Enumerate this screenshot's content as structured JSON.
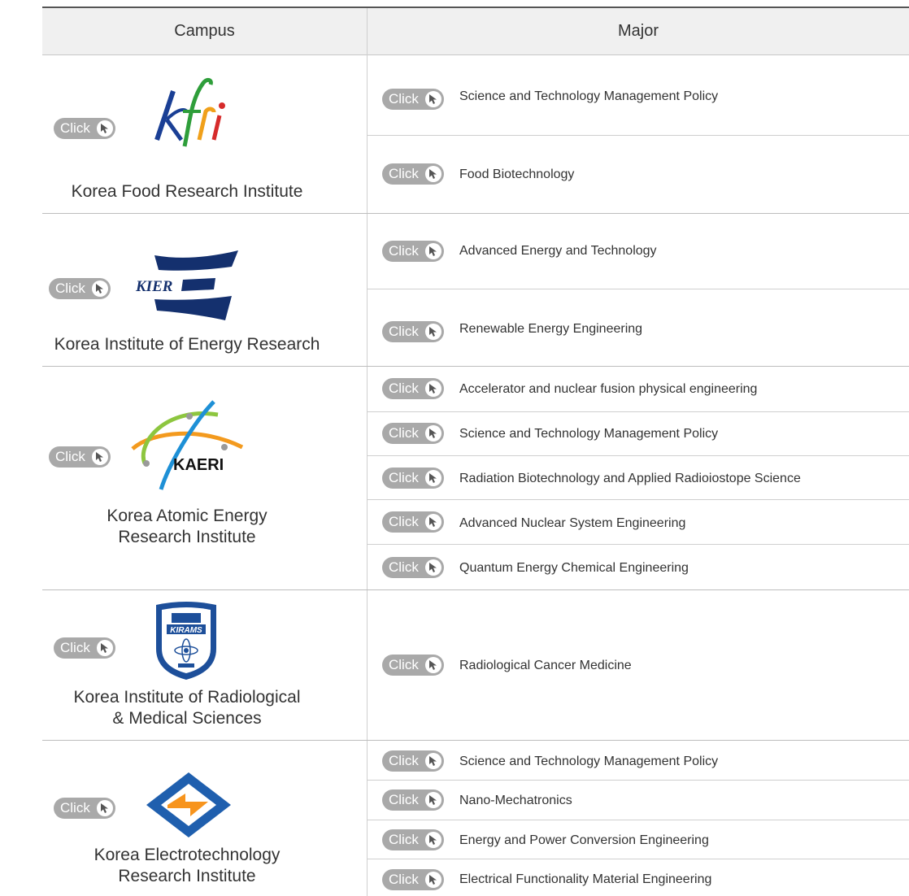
{
  "header": {
    "campus": "Campus",
    "major": "Major"
  },
  "click_label": "Click",
  "institutes": [
    {
      "name": "Korea Food Research Institute",
      "logo_text": "kfri",
      "majors": [
        "Science and Technology Management Policy",
        "Food Biotechnology"
      ]
    },
    {
      "name": "Korea Institute of Energy Research",
      "logo_text": "KIER",
      "majors": [
        "Advanced Energy and Technology",
        "Renewable Energy Engineering"
      ]
    },
    {
      "name_lines": [
        "Korea Atomic Energy",
        "Research Institute"
      ],
      "logo_text": "KAERI",
      "majors": [
        "Accelerator and nuclear fusion physical engineering",
        "Science and Technology Management Policy",
        "Radiation Biotechnology and Applied Radioiostope Science",
        "Advanced Nuclear System Engineering",
        "Quantum Energy Chemical Engineering"
      ]
    },
    {
      "name_lines": [
        "Korea Institute of Radiological",
        "& Medical Sciences"
      ],
      "logo_text": "KIRAMS",
      "majors": [
        "Radiological Cancer Medicine"
      ]
    },
    {
      "name_lines": [
        "Korea Electrotechnology",
        "Research Institute"
      ],
      "majors": [
        "Science and Technology Management Policy",
        "Nano-Mechatronics",
        "Energy and Power Conversion Engineering",
        "Electrical Functionality Material Engineering"
      ]
    }
  ],
  "colors": {
    "button": "#a9a9a9",
    "kier_blue": "#14306e",
    "kaeri_orange": "#f39a1e",
    "kaeri_green": "#8dc63f",
    "kaeri_blue": "#1e90d6",
    "keri_blue": "#1f5fae",
    "keri_orange": "#f7941d"
  }
}
